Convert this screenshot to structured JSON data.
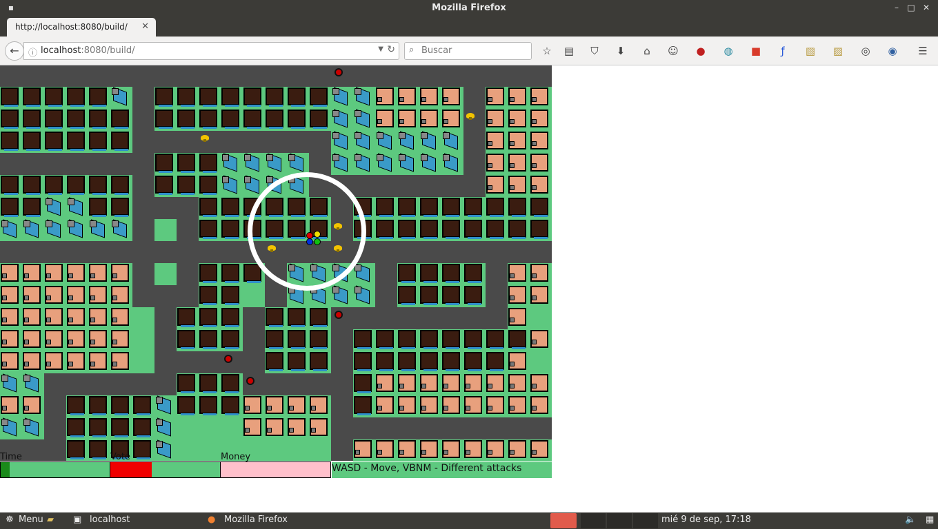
{
  "window": {
    "title": "Mozilla Firefox",
    "buttons": [
      "–",
      "□",
      "✕"
    ]
  },
  "tab": {
    "label": "http://localhost:8080/build/",
    "close": "✕",
    "new_tab": "+"
  },
  "nav": {
    "url_host": "localhost",
    "url_rest": ":8080/build/",
    "search_placeholder": "Buscar"
  },
  "game": {
    "hud": {
      "time_label": "Time",
      "vote_label": "Vote",
      "money_label": "Money",
      "time_fill": 0.08,
      "vote_fill": 0.38,
      "money_fill": 1.0,
      "hint": "WASD - Move, VBNM - Different attacks"
    }
  },
  "taskbar": {
    "menu": "Menu",
    "terminal": "localhost",
    "firefox": "Mozilla Firefox",
    "clock": "mié  9 de sep, 17:18"
  },
  "colors": {
    "road": "#4a4a4a",
    "grass": "#5dc97f",
    "house_dark": "#3a1c10",
    "house_orange": "#e8a07d",
    "house_blue": "#3a9ac8",
    "vote_bar": "#f00000",
    "time_bar": "#1a8a1a",
    "money_bar": "#ffc0cb"
  }
}
